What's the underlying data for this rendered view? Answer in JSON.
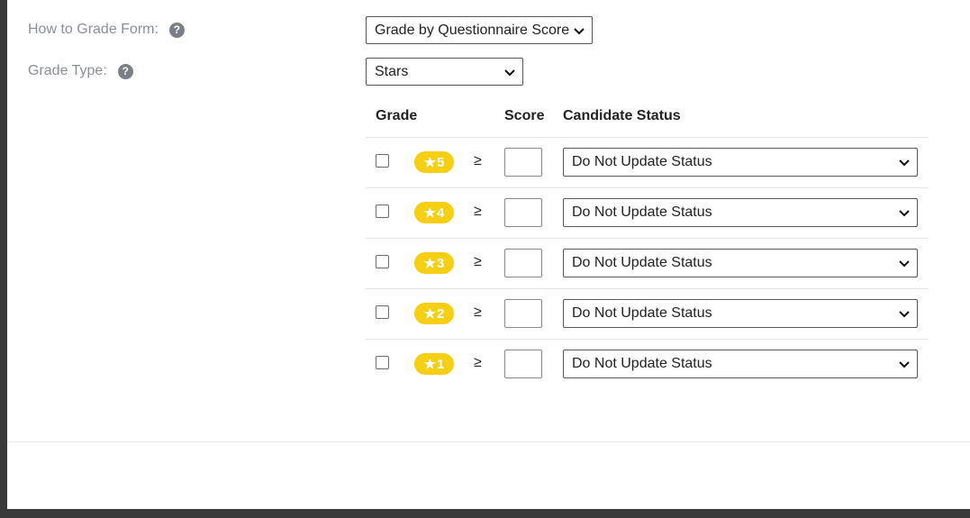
{
  "form": {
    "how_to_grade_label": "How to Grade Form:",
    "how_to_grade_value": "Grade by Questionnaire Score",
    "grade_type_label": "Grade Type:",
    "grade_type_value": "Stars",
    "help_glyph": "?"
  },
  "table": {
    "headers": {
      "grade": "Grade",
      "score": "Score",
      "status": "Candidate Status"
    },
    "comparator": "≥",
    "star_glyph": "★",
    "rows": [
      {
        "grade": "5",
        "score": "",
        "status": "Do Not Update Status"
      },
      {
        "grade": "4",
        "score": "",
        "status": "Do Not Update Status"
      },
      {
        "grade": "3",
        "score": "",
        "status": "Do Not Update Status"
      },
      {
        "grade": "2",
        "score": "",
        "status": "Do Not Update Status"
      },
      {
        "grade": "1",
        "score": "",
        "status": "Do Not Update Status"
      }
    ]
  },
  "colors": {
    "badge": "#f7cf12",
    "label": "#8a8f96",
    "help": "#7a7f87"
  },
  "icons": {
    "help": "help-circle-icon",
    "chevron": "chevron-down-icon",
    "star": "star-icon"
  }
}
